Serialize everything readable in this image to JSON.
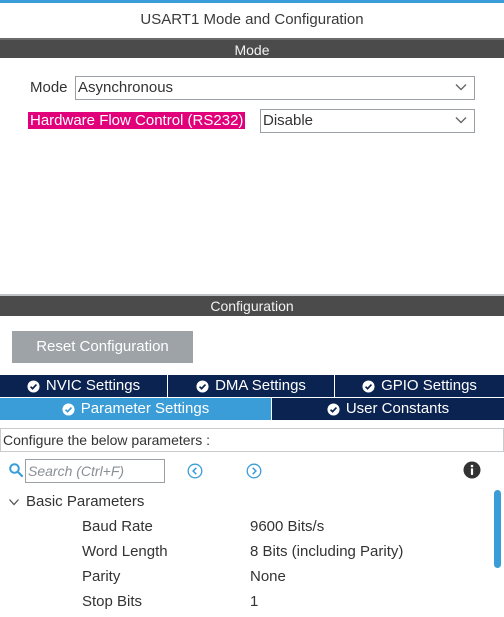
{
  "window": {
    "title": "USART1 Mode and Configuration"
  },
  "mode_section": {
    "header": "Mode",
    "mode_label": "Mode",
    "mode_value": "Asynchronous",
    "hfc_label": "Hardware Flow Control (RS232)",
    "hfc_value": "Disable"
  },
  "config_section": {
    "header": "Configuration",
    "reset_label": "Reset Configuration",
    "tabs_row1": [
      "NVIC Settings",
      "DMA Settings",
      "GPIO Settings"
    ],
    "tabs_row2": [
      "Parameter Settings",
      "User Constants"
    ],
    "active_tab": "Parameter Settings",
    "info_text": "Configure the below parameters :",
    "search_placeholder": "Search (Ctrl+F)"
  },
  "parameters": {
    "group_label": "Basic Parameters",
    "rows": [
      {
        "name": "Baud Rate",
        "value": "9600 Bits/s"
      },
      {
        "name": "Word Length",
        "value": "8 Bits (including Parity)"
      },
      {
        "name": "Parity",
        "value": "None"
      },
      {
        "name": "Stop Bits",
        "value": "1"
      }
    ]
  },
  "colors": {
    "accent": "#3b9dd8",
    "tab_dark": "#0b2350",
    "band": "#4b4b4b",
    "highlight": "#e2007a",
    "button": "#9ea3a7"
  },
  "icons": {
    "search": "search-icon",
    "prev": "chevron-left-circle-icon",
    "next": "chevron-right-circle-icon",
    "info": "info-icon",
    "expand": "chevron-down-icon",
    "tab_status": "check-circle-icon"
  }
}
